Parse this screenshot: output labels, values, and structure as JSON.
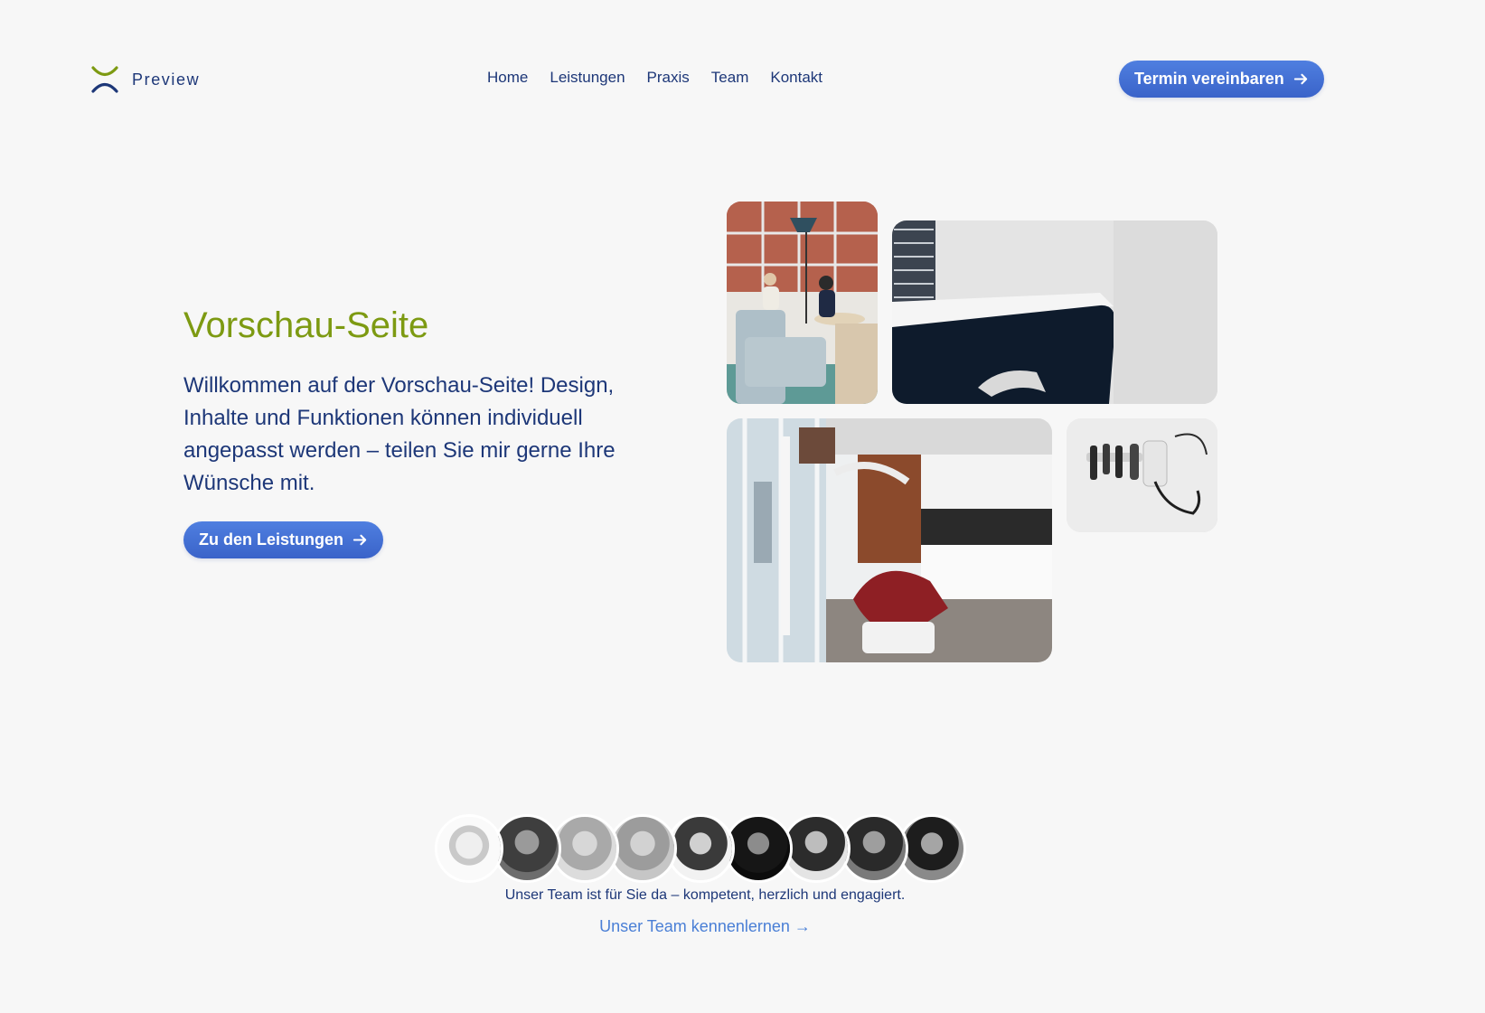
{
  "header": {
    "logo_text": "Preview",
    "nav": [
      {
        "label": "Home"
      },
      {
        "label": "Leistungen"
      },
      {
        "label": "Praxis"
      },
      {
        "label": "Team"
      },
      {
        "label": "Kontakt"
      }
    ],
    "cta_label": "Termin vereinbaren"
  },
  "hero": {
    "title": "Vorschau-Seite",
    "text": "Willkommen auf der Vorschau-Seite! Design, Inhalte und Funktionen können individuell angepasst werden – teilen Sie mir gerne Ihre Wünsche mit.",
    "button_label": "Zu den Leistungen"
  },
  "gallery": {
    "photos": [
      {
        "subject": "waiting-room-photo"
      },
      {
        "subject": "treatment-bed-photo"
      },
      {
        "subject": "dental-treatment-room-photo"
      },
      {
        "subject": "wall-medical-instruments-photo"
      }
    ]
  },
  "team": {
    "member_count": 9,
    "caption": "Unser Team ist für Sie da – kompetent, herzlich und engagiert.",
    "link_label": "Unser Team kennenlernen →"
  },
  "colors": {
    "background": "#f7f7f7",
    "primary_text": "#1d3778",
    "title_green": "#7d9a12",
    "button_blue": "#4070d8",
    "link_blue": "#4a7fd6"
  }
}
